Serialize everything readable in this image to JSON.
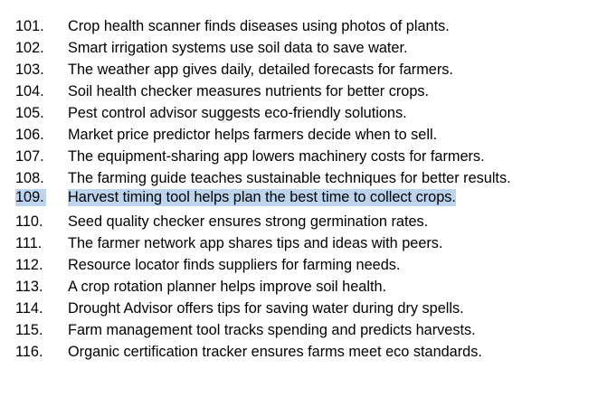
{
  "selected_index": 8,
  "items": [
    {
      "num": "101.",
      "text": "Crop health scanner finds diseases using photos of plants."
    },
    {
      "num": "102.",
      "text": "Smart irrigation systems use soil data to save water."
    },
    {
      "num": "103.",
      "text": "The weather app gives daily, detailed forecasts for farmers."
    },
    {
      "num": "104.",
      "text": "Soil health checker measures nutrients for better crops."
    },
    {
      "num": "105.",
      "text": "Pest control advisor suggests eco-friendly solutions."
    },
    {
      "num": "106.",
      "text": "Market price predictor helps farmers decide when to sell."
    },
    {
      "num": "107.",
      "text": "The equipment-sharing app lowers machinery costs for farmers."
    },
    {
      "num": "108.",
      "text": "The farming guide teaches sustainable techniques for better results."
    },
    {
      "num": "109.",
      "text": "Harvest timing tool helps plan the best time to collect crops."
    },
    {
      "num": "110.",
      "text": "Seed quality checker ensures strong germination rates."
    },
    {
      "num": "111.",
      "text": "The farmer network app shares tips and ideas with peers."
    },
    {
      "num": "112.",
      "text": "Resource locator finds suppliers for farming needs."
    },
    {
      "num": "113.",
      "text": "A crop rotation planner helps improve soil health."
    },
    {
      "num": "114.",
      "text": "Drought Advisor offers tips for saving water during dry spells."
    },
    {
      "num": "115.",
      "text": "Farm management tool tracks spending and predicts harvests."
    },
    {
      "num": "116.",
      "text": "Organic certification tracker ensures farms meet eco standards."
    }
  ],
  "colors": {
    "selection": "#bcd4ee",
    "text": "#000000",
    "background": "#ffffff"
  }
}
